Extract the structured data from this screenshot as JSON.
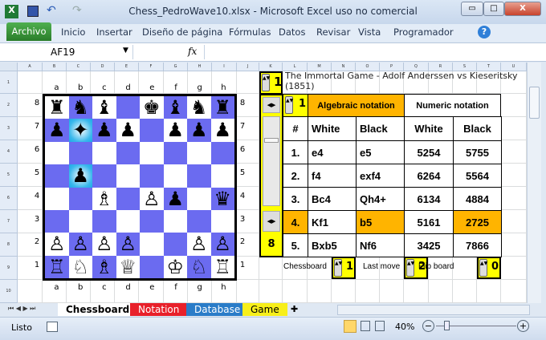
{
  "window": {
    "title": "Chess_PedroWave10.xlsx  -  Microsoft Excel uso no comercial",
    "minimize": "▭",
    "maximize": "□",
    "close": "X"
  },
  "ribbon": {
    "file": "Archivo",
    "tabs": [
      "Inicio",
      "Insertar",
      "Diseño de página",
      "Fórmulas",
      "Datos",
      "Revisar",
      "Vista",
      "Programador"
    ]
  },
  "formula_bar": {
    "name_box": "AF19",
    "fx": "fx",
    "value": ""
  },
  "columns": [
    "A",
    "B",
    "C",
    "D",
    "E",
    "F",
    "G",
    "H",
    "I",
    "J",
    "K",
    "L",
    "M",
    "N",
    "O",
    "P",
    "Q",
    "R",
    "S",
    "T",
    "U"
  ],
  "rows": [
    "1",
    "2",
    "3",
    "4",
    "5",
    "6",
    "7",
    "8",
    "9",
    "10"
  ],
  "board": {
    "files": [
      "a",
      "b",
      "c",
      "d",
      "e",
      "f",
      "g",
      "h"
    ],
    "ranks": [
      "8",
      "7",
      "6",
      "5",
      "4",
      "3",
      "2",
      "1"
    ],
    "squares": [
      [
        "♜",
        "♞",
        "♝",
        "",
        "♚",
        "♝",
        "♞",
        "♜"
      ],
      [
        "♟",
        "✦",
        "♟",
        "♟",
        "",
        "♟",
        "♟",
        "♟"
      ],
      [
        "",
        "",
        "",
        "",
        "",
        "",
        "",
        ""
      ],
      [
        "",
        "♟",
        "",
        "",
        "",
        "",
        "",
        ""
      ],
      [
        "",
        "",
        "♗",
        "",
        "♙",
        "♟",
        "",
        "♛"
      ],
      [
        "",
        "",
        "",
        "",
        "",
        "",
        "",
        ""
      ],
      [
        "♙",
        "♙",
        "♙",
        "♙",
        "",
        "",
        "♙",
        "♙"
      ],
      [
        "♖",
        "♘",
        "♗",
        "♕",
        "",
        "♔",
        "♘",
        "♖"
      ]
    ],
    "highlight": [
      [
        1,
        1
      ],
      [
        3,
        1
      ]
    ],
    "colors": {
      "dark": "#6b6bf0",
      "light": "#ffffff",
      "highlight": "#2ab0ea"
    }
  },
  "game": {
    "spinner_value": "1",
    "title": "The Immortal Game  -  Adolf Anderssen vs Kieseritsky (1851)"
  },
  "notation": {
    "page_value": "1",
    "algebraic_header": "Algebraic notation",
    "numeric_header": "Numeric notation",
    "col_headers": [
      "#",
      "White",
      "Black",
      "White",
      "Black"
    ],
    "moves": [
      {
        "n": "1.",
        "w": "e4",
        "b": "e5",
        "nw": "5254",
        "nb": "5755"
      },
      {
        "n": "2.",
        "w": "f4",
        "b": "exf4",
        "nw": "6264",
        "nb": "5564"
      },
      {
        "n": "3.",
        "w": "Bc4",
        "b": "Qh4+",
        "nw": "6134",
        "nb": "4884"
      },
      {
        "n": "4.",
        "w": "Kf1",
        "b": "b5",
        "nw": "5161",
        "nb": "2725"
      },
      {
        "n": "5.",
        "w": "Bxb5",
        "b": "Nf6",
        "nw": "3425",
        "nb": "7866"
      }
    ],
    "scroll_value": "8",
    "current_row": 3
  },
  "controls": {
    "chessboard_label": "Chessboard",
    "chessboard_value": "1",
    "last_move_label": "Last move",
    "last_move_value": "2",
    "flip_label": "Flip board",
    "flip_value": "0"
  },
  "sheets": [
    "Chessboard",
    "Notation",
    "Database",
    "Game"
  ],
  "status": {
    "ready": "Listo",
    "zoom": "40%"
  }
}
